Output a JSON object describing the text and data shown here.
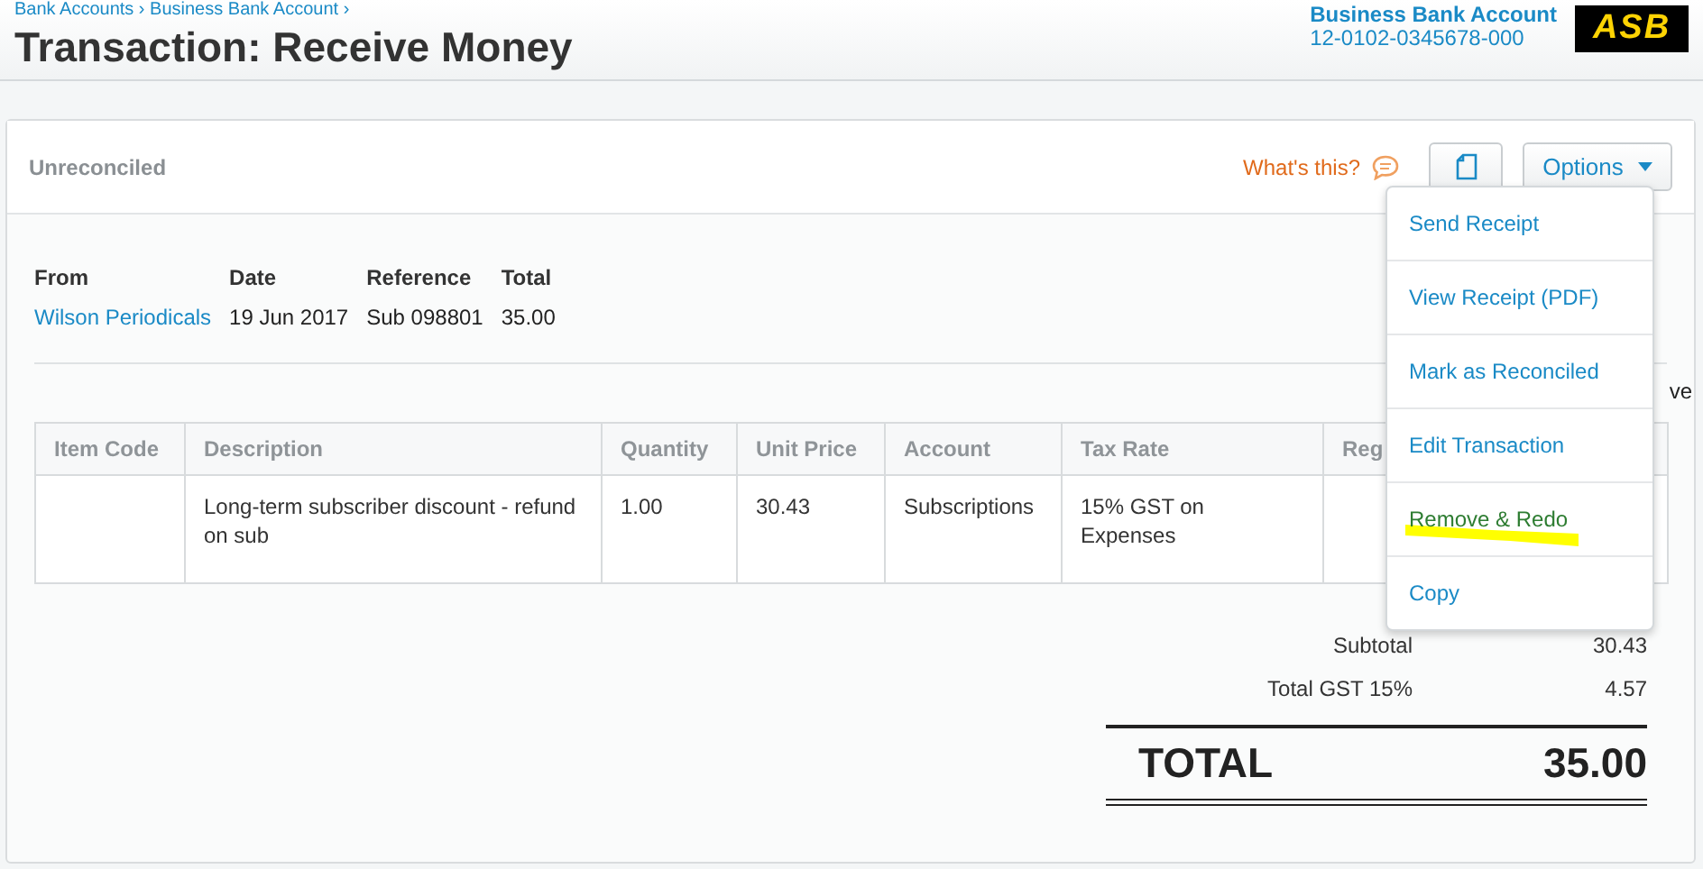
{
  "breadcrumb": "Bank Accounts › Business Bank Account ›",
  "title": "Transaction: Receive Money",
  "account": {
    "name": "Business Bank Account",
    "number": "12-0102-0345678-000"
  },
  "logo": "ASB",
  "status": "Unreconciled",
  "whats_this": "What's this?",
  "options_button": "Options",
  "menu": [
    {
      "label": "Send Receipt",
      "highlighted": false
    },
    {
      "label": "View Receipt (PDF)",
      "highlighted": false
    },
    {
      "label": "Mark as Reconciled",
      "highlighted": false
    },
    {
      "label": "Edit Transaction",
      "highlighted": false
    },
    {
      "label": "Remove & Redo",
      "highlighted": true
    },
    {
      "label": "Copy",
      "highlighted": false
    }
  ],
  "summary": {
    "columns": [
      "From",
      "Date",
      "Reference",
      "Total"
    ],
    "values": [
      {
        "text": "Wilson Periodicals",
        "kind": "link"
      },
      {
        "text": "19 Jun 2017",
        "kind": "plain"
      },
      {
        "text": "Sub 098801",
        "kind": "plain"
      },
      {
        "text": "35.00",
        "kind": "plain"
      }
    ]
  },
  "tax_note": "ve",
  "table": {
    "columns": [
      "Item Code",
      "Description",
      "Quantity",
      "Unit Price",
      "Account",
      "Tax Rate",
      "Reg"
    ],
    "rows": [
      [
        "",
        "Long-term subscriber discount - refund on sub",
        "1.00",
        "30.43",
        "Subscriptions",
        "15% GST on Expenses",
        ""
      ]
    ]
  },
  "totals": [
    {
      "label": "Subtotal",
      "value": "30.43"
    },
    {
      "label": "Total GST 15%",
      "value": "4.57"
    }
  ],
  "grand_total": {
    "label": "TOTAL",
    "value": "35.00"
  }
}
